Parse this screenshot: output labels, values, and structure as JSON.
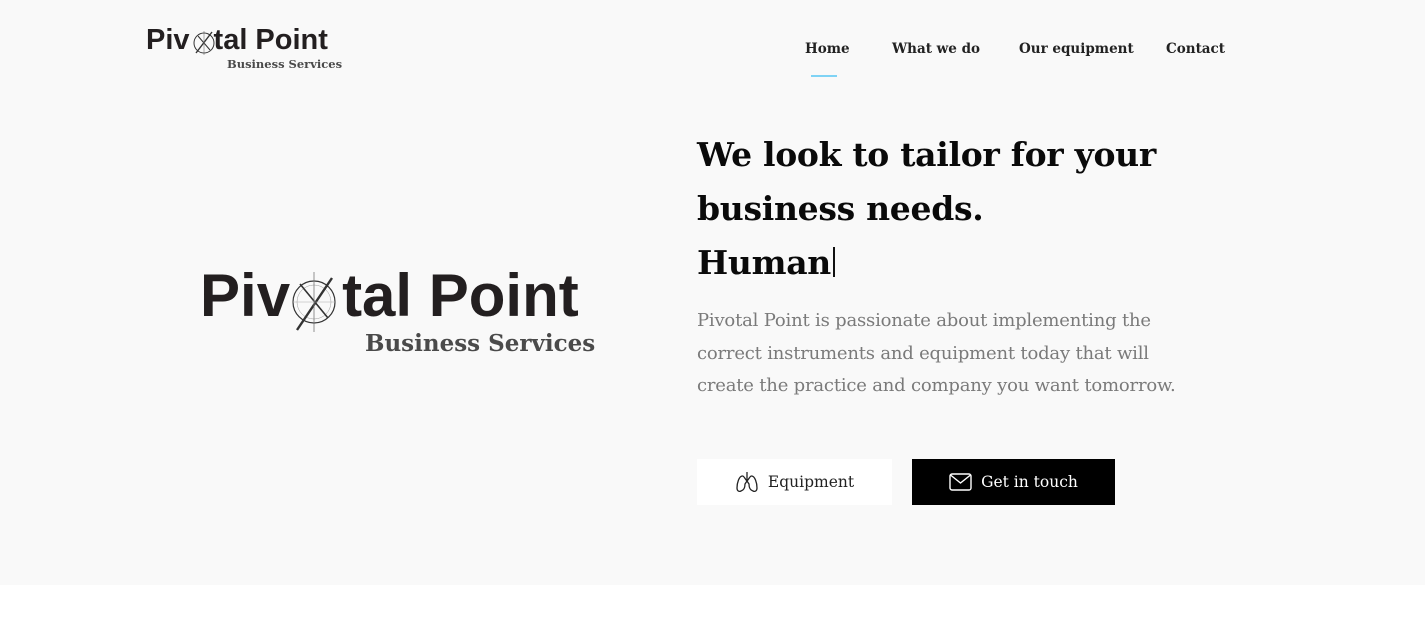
{
  "brand": {
    "name_part1": "Piv",
    "name_part2": "tal Point",
    "tagline": "Business Services",
    "logo_icon": "compass-icon"
  },
  "nav": {
    "items": [
      {
        "label": "Home",
        "active": true
      },
      {
        "label": "What we do",
        "active": false
      },
      {
        "label": "Our equipment",
        "active": false
      },
      {
        "label": "Contact",
        "active": false
      }
    ],
    "active_underline_color": "#7fd3f5"
  },
  "hero": {
    "headline_line1": "We look to tailor for your",
    "headline_line2": "business needs.",
    "typed_word": "Human",
    "description_lines": [
      "Pivotal Point is passionate about implementing the",
      "correct instruments and equipment today that will",
      "create the practice and company you want tomorrow."
    ],
    "buttons": {
      "equipment": {
        "label": "Equipment",
        "icon": "lungs-icon"
      },
      "contact": {
        "label": "Get in touch",
        "icon": "envelope-icon"
      }
    }
  },
  "colors": {
    "background": "#f9f9f9",
    "text": "#0a0a0a",
    "muted_text": "#7a7a7a",
    "primary_button": "#000000"
  }
}
